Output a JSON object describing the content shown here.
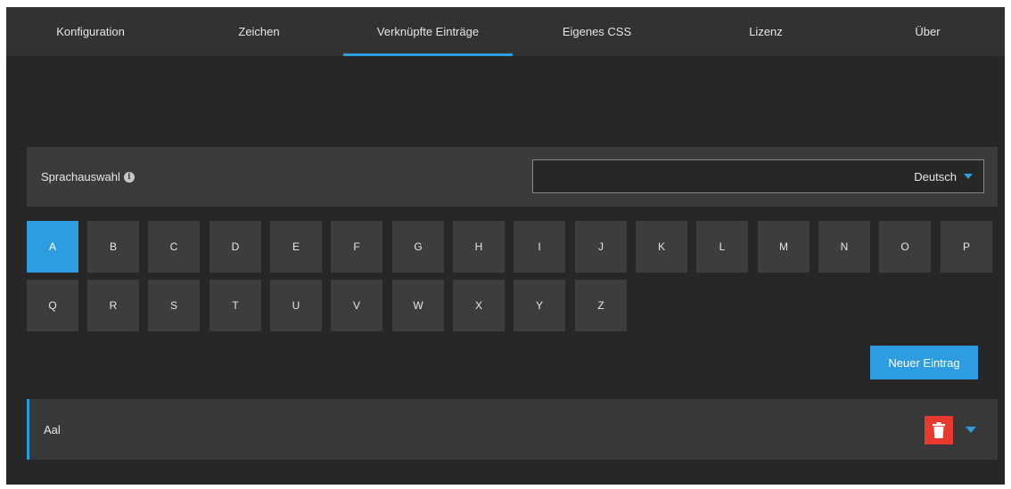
{
  "tabs": [
    {
      "label": "Konfiguration",
      "active": false
    },
    {
      "label": "Zeichen",
      "active": false
    },
    {
      "label": "Verknüpfte Einträge",
      "active": true
    },
    {
      "label": "Eigenes CSS",
      "active": false
    },
    {
      "label": "Lizenz",
      "active": false
    },
    {
      "label": "Über",
      "active": false
    }
  ],
  "language": {
    "label": "Sprachauswahl",
    "info_icon": "info-circle-icon",
    "selected": "Deutsch"
  },
  "letters": {
    "row1": [
      "A",
      "B",
      "C",
      "D",
      "E",
      "F",
      "G",
      "H",
      "I",
      "J",
      "K",
      "L",
      "M",
      "N",
      "O",
      "P"
    ],
    "row2": [
      "Q",
      "R",
      "S",
      "T",
      "U",
      "V",
      "W",
      "X",
      "Y",
      "Z"
    ],
    "active": "A"
  },
  "new_entry_label": "Neuer Eintrag",
  "entries": [
    {
      "name": "Aal"
    }
  ],
  "colors": {
    "accent": "#2e9ce0",
    "danger": "#e8392f",
    "background": "#272727"
  }
}
